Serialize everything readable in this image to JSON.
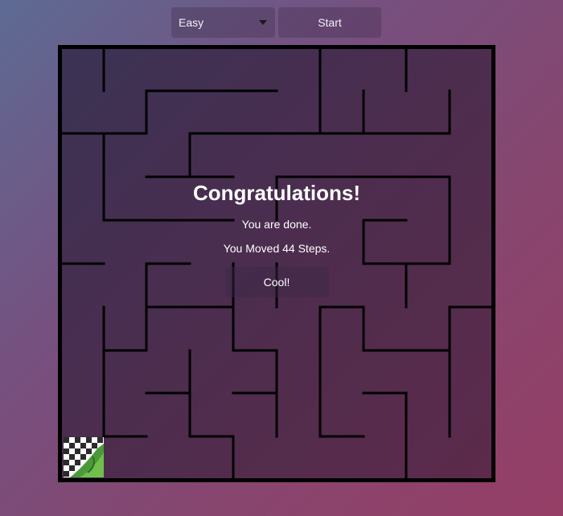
{
  "controls": {
    "difficulty_selected": "Easy",
    "start_label": "Start"
  },
  "game": {
    "grid_size": 10,
    "start_cell": "bottom-left",
    "goal_icon": "checkered-flag-icon"
  },
  "message": {
    "title": "Congratulations!",
    "line1": "You are done.",
    "line2": "You Moved 44 Steps.",
    "button_label": "Cool!"
  },
  "colors": {
    "wall": "#000000",
    "text": "#ffffff"
  }
}
